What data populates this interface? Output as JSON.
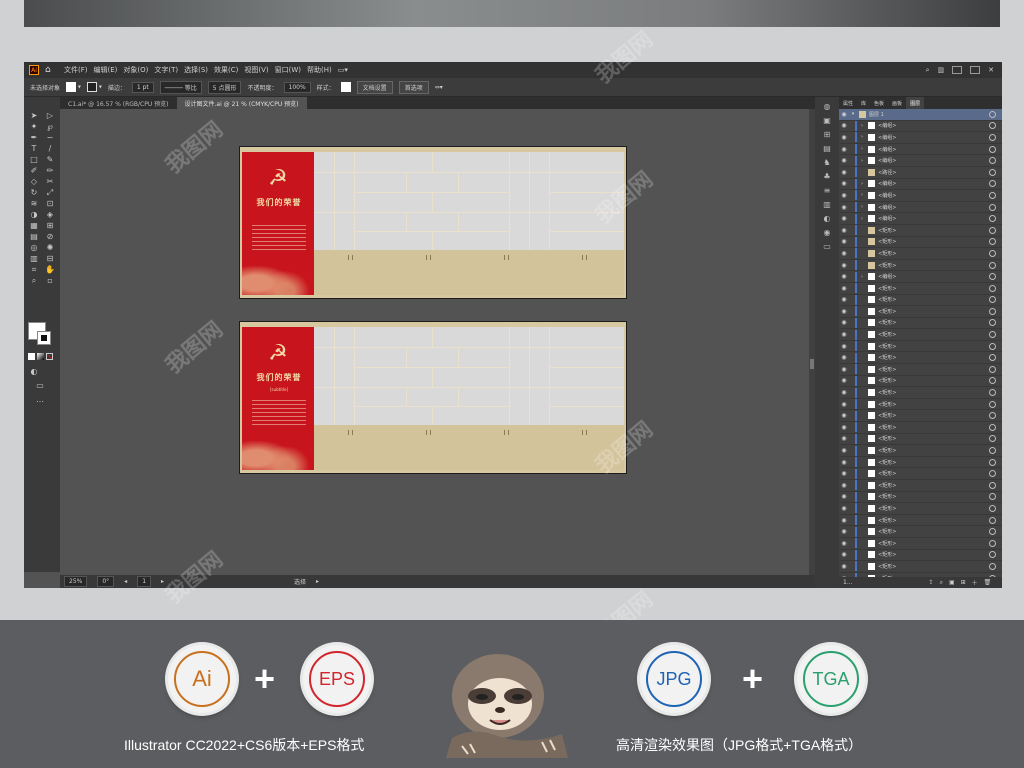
{
  "app": {
    "logo": "Ai",
    "menus": [
      "文件(F)",
      "编辑(E)",
      "对象(O)",
      "文字(T)",
      "选择(S)",
      "效果(C)",
      "视图(V)",
      "窗口(W)",
      "帮助(H)"
    ]
  },
  "control_bar": {
    "no_selection": "未选择对象",
    "stroke_label": "描边：",
    "stroke_value": "1 pt",
    "line_style": "等比",
    "brush": "5 点圆形",
    "opacity_label": "不透明度：",
    "opacity_value": "100%",
    "style_label": "样式：",
    "doc_setup_button": "文档设置",
    "preferences_button": "首选项"
  },
  "tabs": [
    {
      "label": "C1.ai* @ 16.57 % (RGB/CPU 预览)",
      "active": false
    },
    {
      "label": "设计图文件.ai @ 21 % (CMYK/CPU 预览)",
      "active": true
    }
  ],
  "artboard": {
    "title": "我们的荣誉",
    "subtitle": "[subtitle]",
    "emblem": "☭"
  },
  "status_bar": {
    "zoom": "25%",
    "rotation": "0°",
    "artboard_index": "1",
    "tool": "选择"
  },
  "layers_panel": {
    "tabs": [
      "属性",
      "库",
      "色板",
      "画板",
      "图层"
    ],
    "active_tab": "图层",
    "top_layer": "图层 1",
    "rows": [
      {
        "label": "<编组>",
        "arrow": true,
        "thumb": "white"
      },
      {
        "label": "<编组>",
        "arrow": true,
        "thumb": "white"
      },
      {
        "label": "<编组>",
        "arrow": true,
        "thumb": "white"
      },
      {
        "label": "<编组>",
        "arrow": true,
        "thumb": "white"
      },
      {
        "label": "<路径>",
        "arrow": false,
        "thumb": "tan"
      },
      {
        "label": "<编组>",
        "arrow": true,
        "thumb": "white"
      },
      {
        "label": "<编组>",
        "arrow": true,
        "thumb": "white"
      },
      {
        "label": "<编组>",
        "arrow": true,
        "thumb": "white"
      },
      {
        "label": "<编组>",
        "arrow": true,
        "thumb": "white"
      },
      {
        "label": "<矩形>",
        "arrow": false,
        "thumb": "tan"
      },
      {
        "label": "<矩形>",
        "arrow": false,
        "thumb": "tan"
      },
      {
        "label": "<矩形>",
        "arrow": false,
        "thumb": "tan"
      },
      {
        "label": "<矩形>",
        "arrow": false,
        "thumb": "tan"
      },
      {
        "label": "<编组>",
        "arrow": true,
        "thumb": "white"
      },
      {
        "label": "<矩形>",
        "arrow": false,
        "thumb": "white"
      },
      {
        "label": "<矩形>",
        "arrow": false,
        "thumb": "white"
      },
      {
        "label": "<矩形>",
        "arrow": false,
        "thumb": "white"
      },
      {
        "label": "<矩形>",
        "arrow": false,
        "thumb": "white"
      },
      {
        "label": "<矩形>",
        "arrow": false,
        "thumb": "white"
      },
      {
        "label": "<矩形>",
        "arrow": false,
        "thumb": "white"
      },
      {
        "label": "<矩形>",
        "arrow": false,
        "thumb": "white"
      },
      {
        "label": "<矩形>",
        "arrow": false,
        "thumb": "white"
      },
      {
        "label": "<矩形>",
        "arrow": false,
        "thumb": "white"
      },
      {
        "label": "<矩形>",
        "arrow": false,
        "thumb": "white"
      },
      {
        "label": "<矩形>",
        "arrow": false,
        "thumb": "white"
      },
      {
        "label": "<矩形>",
        "arrow": false,
        "thumb": "white"
      },
      {
        "label": "<矩形>",
        "arrow": false,
        "thumb": "white"
      },
      {
        "label": "<矩形>",
        "arrow": false,
        "thumb": "white"
      },
      {
        "label": "<矩形>",
        "arrow": false,
        "thumb": "white"
      },
      {
        "label": "<矩形>",
        "arrow": false,
        "thumb": "white"
      },
      {
        "label": "<矩形>",
        "arrow": false,
        "thumb": "white"
      },
      {
        "label": "<矩形>",
        "arrow": false,
        "thumb": "white"
      },
      {
        "label": "<矩形>",
        "arrow": false,
        "thumb": "white"
      },
      {
        "label": "<矩形>",
        "arrow": false,
        "thumb": "white"
      },
      {
        "label": "<矩形>",
        "arrow": false,
        "thumb": "white"
      },
      {
        "label": "<矩形>",
        "arrow": false,
        "thumb": "white"
      },
      {
        "label": "<矩形>",
        "arrow": false,
        "thumb": "white"
      },
      {
        "label": "<矩形>",
        "arrow": false,
        "thumb": "white"
      },
      {
        "label": "<矩形>",
        "arrow": false,
        "thumb": "white"
      },
      {
        "label": "<矩形>",
        "arrow": false,
        "thumb": "white"
      },
      {
        "label": "<矩形>",
        "arrow": false,
        "thumb": "white"
      },
      {
        "label": "<矩形>",
        "arrow": false,
        "thumb": "white"
      },
      {
        "label": "<矩形>",
        "arrow": false,
        "thumb": "white"
      }
    ],
    "layer_count": "1..."
  },
  "promo": {
    "badges": [
      {
        "label": "Ai",
        "color": "#c8701e"
      },
      {
        "label": "EPS",
        "color": "#d0262c"
      },
      {
        "label": "JPG",
        "color": "#1e64b4"
      },
      {
        "label": "TGA",
        "color": "#2ba06e"
      }
    ],
    "plus": "+",
    "left_caption": "Illustrator CC2022+CS6版本+EPS格式",
    "right_caption": "高清渲染效果图（JPG格式+TGA格式）",
    "watermark": "我图网"
  }
}
